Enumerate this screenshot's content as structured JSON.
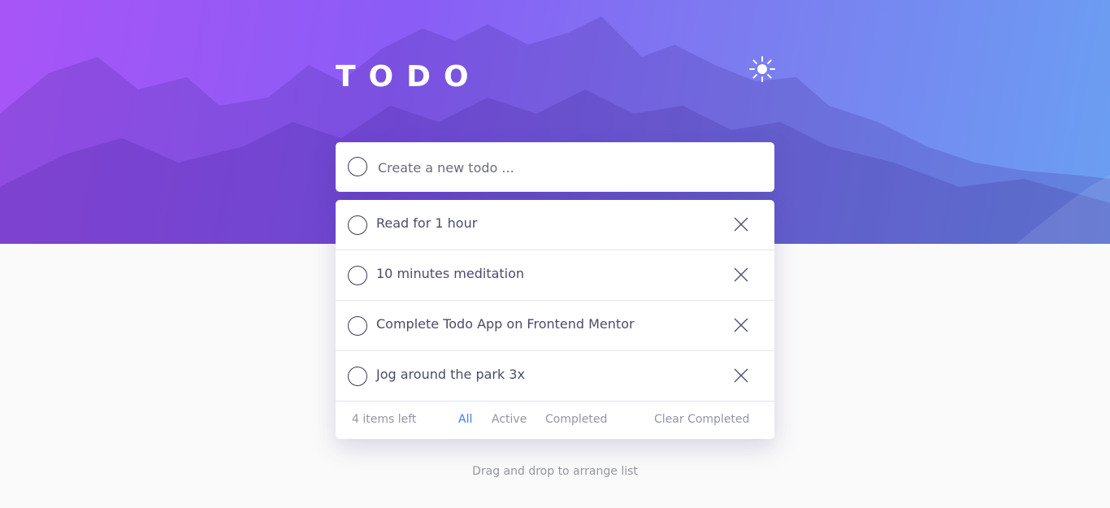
{
  "header": {
    "title": "TODO",
    "theme_icon": "sun-icon"
  },
  "new_todo": {
    "placeholder": "Create a new todo ..."
  },
  "todos": [
    {
      "text": "Read for 1 hour",
      "completed": false
    },
    {
      "text": "10 minutes meditation",
      "completed": false
    },
    {
      "text": "Complete Todo App on Frontend Mentor",
      "completed": false
    },
    {
      "text": "Jog around the park 3x",
      "completed": false
    }
  ],
  "footer": {
    "items_left": "4 items left",
    "filters": [
      "All",
      "Active",
      "Completed"
    ],
    "active_filter": "All",
    "clear": "Clear Completed"
  },
  "hint": "Drag and drop to arrange list",
  "colors": {
    "accent": "#3a7bfd",
    "gradient_start": "#a855f7",
    "gradient_end": "#6a9ff2",
    "text": "#494c6b",
    "muted": "#9495a5"
  }
}
